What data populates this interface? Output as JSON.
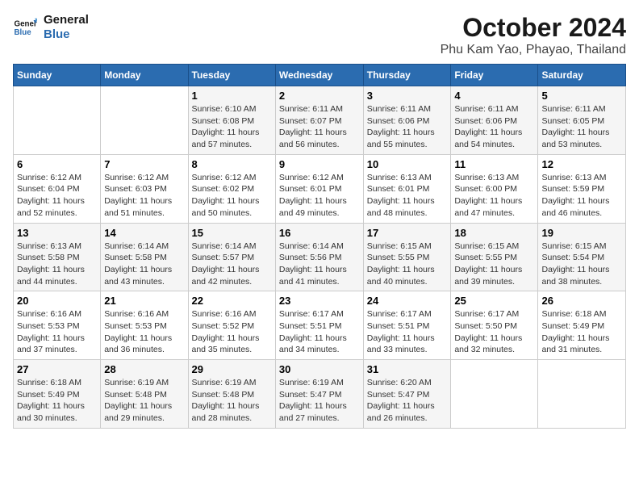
{
  "header": {
    "logo_line1": "General",
    "logo_line2": "Blue",
    "month": "October 2024",
    "location": "Phu Kam Yao, Phayao, Thailand"
  },
  "weekdays": [
    "Sunday",
    "Monday",
    "Tuesday",
    "Wednesday",
    "Thursday",
    "Friday",
    "Saturday"
  ],
  "weeks": [
    [
      {
        "day": "",
        "info": ""
      },
      {
        "day": "",
        "info": ""
      },
      {
        "day": "1",
        "info": "Sunrise: 6:10 AM\nSunset: 6:08 PM\nDaylight: 11 hours and 57 minutes."
      },
      {
        "day": "2",
        "info": "Sunrise: 6:11 AM\nSunset: 6:07 PM\nDaylight: 11 hours and 56 minutes."
      },
      {
        "day": "3",
        "info": "Sunrise: 6:11 AM\nSunset: 6:06 PM\nDaylight: 11 hours and 55 minutes."
      },
      {
        "day": "4",
        "info": "Sunrise: 6:11 AM\nSunset: 6:06 PM\nDaylight: 11 hours and 54 minutes."
      },
      {
        "day": "5",
        "info": "Sunrise: 6:11 AM\nSunset: 6:05 PM\nDaylight: 11 hours and 53 minutes."
      }
    ],
    [
      {
        "day": "6",
        "info": "Sunrise: 6:12 AM\nSunset: 6:04 PM\nDaylight: 11 hours and 52 minutes."
      },
      {
        "day": "7",
        "info": "Sunrise: 6:12 AM\nSunset: 6:03 PM\nDaylight: 11 hours and 51 minutes."
      },
      {
        "day": "8",
        "info": "Sunrise: 6:12 AM\nSunset: 6:02 PM\nDaylight: 11 hours and 50 minutes."
      },
      {
        "day": "9",
        "info": "Sunrise: 6:12 AM\nSunset: 6:01 PM\nDaylight: 11 hours and 49 minutes."
      },
      {
        "day": "10",
        "info": "Sunrise: 6:13 AM\nSunset: 6:01 PM\nDaylight: 11 hours and 48 minutes."
      },
      {
        "day": "11",
        "info": "Sunrise: 6:13 AM\nSunset: 6:00 PM\nDaylight: 11 hours and 47 minutes."
      },
      {
        "day": "12",
        "info": "Sunrise: 6:13 AM\nSunset: 5:59 PM\nDaylight: 11 hours and 46 minutes."
      }
    ],
    [
      {
        "day": "13",
        "info": "Sunrise: 6:13 AM\nSunset: 5:58 PM\nDaylight: 11 hours and 44 minutes."
      },
      {
        "day": "14",
        "info": "Sunrise: 6:14 AM\nSunset: 5:58 PM\nDaylight: 11 hours and 43 minutes."
      },
      {
        "day": "15",
        "info": "Sunrise: 6:14 AM\nSunset: 5:57 PM\nDaylight: 11 hours and 42 minutes."
      },
      {
        "day": "16",
        "info": "Sunrise: 6:14 AM\nSunset: 5:56 PM\nDaylight: 11 hours and 41 minutes."
      },
      {
        "day": "17",
        "info": "Sunrise: 6:15 AM\nSunset: 5:55 PM\nDaylight: 11 hours and 40 minutes."
      },
      {
        "day": "18",
        "info": "Sunrise: 6:15 AM\nSunset: 5:55 PM\nDaylight: 11 hours and 39 minutes."
      },
      {
        "day": "19",
        "info": "Sunrise: 6:15 AM\nSunset: 5:54 PM\nDaylight: 11 hours and 38 minutes."
      }
    ],
    [
      {
        "day": "20",
        "info": "Sunrise: 6:16 AM\nSunset: 5:53 PM\nDaylight: 11 hours and 37 minutes."
      },
      {
        "day": "21",
        "info": "Sunrise: 6:16 AM\nSunset: 5:53 PM\nDaylight: 11 hours and 36 minutes."
      },
      {
        "day": "22",
        "info": "Sunrise: 6:16 AM\nSunset: 5:52 PM\nDaylight: 11 hours and 35 minutes."
      },
      {
        "day": "23",
        "info": "Sunrise: 6:17 AM\nSunset: 5:51 PM\nDaylight: 11 hours and 34 minutes."
      },
      {
        "day": "24",
        "info": "Sunrise: 6:17 AM\nSunset: 5:51 PM\nDaylight: 11 hours and 33 minutes."
      },
      {
        "day": "25",
        "info": "Sunrise: 6:17 AM\nSunset: 5:50 PM\nDaylight: 11 hours and 32 minutes."
      },
      {
        "day": "26",
        "info": "Sunrise: 6:18 AM\nSunset: 5:49 PM\nDaylight: 11 hours and 31 minutes."
      }
    ],
    [
      {
        "day": "27",
        "info": "Sunrise: 6:18 AM\nSunset: 5:49 PM\nDaylight: 11 hours and 30 minutes."
      },
      {
        "day": "28",
        "info": "Sunrise: 6:19 AM\nSunset: 5:48 PM\nDaylight: 11 hours and 29 minutes."
      },
      {
        "day": "29",
        "info": "Sunrise: 6:19 AM\nSunset: 5:48 PM\nDaylight: 11 hours and 28 minutes."
      },
      {
        "day": "30",
        "info": "Sunrise: 6:19 AM\nSunset: 5:47 PM\nDaylight: 11 hours and 27 minutes."
      },
      {
        "day": "31",
        "info": "Sunrise: 6:20 AM\nSunset: 5:47 PM\nDaylight: 11 hours and 26 minutes."
      },
      {
        "day": "",
        "info": ""
      },
      {
        "day": "",
        "info": ""
      }
    ]
  ]
}
